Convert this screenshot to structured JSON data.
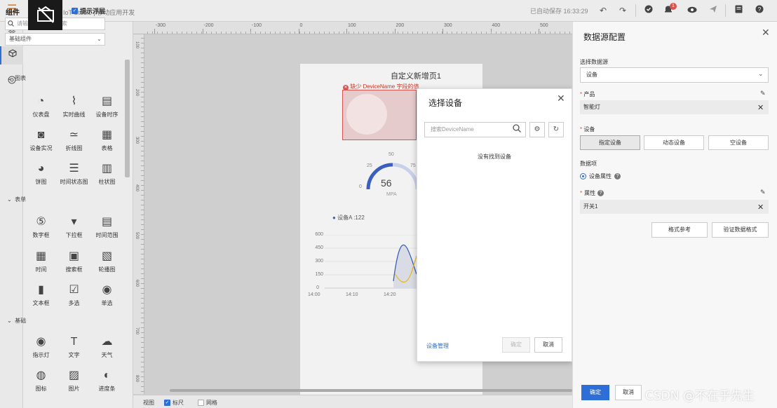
{
  "topbar": {
    "app_title": "IoT Studio | 移动应用开发",
    "autosave": "已自动保存 16:33:29",
    "notification_count": "1"
  },
  "panel": {
    "title": "组件",
    "show_float": "提示浮层",
    "search_placeholder": "请输入组件名称搜索",
    "basic_select": "基础组件",
    "sections": [
      "图表",
      "表单",
      "基础"
    ],
    "charts": [
      "仪表盘",
      "实时曲线",
      "设备时序",
      "设备实况",
      "折线图",
      "表格",
      "饼图",
      "时间状态图",
      "柱状图"
    ],
    "forms": [
      "数字框",
      "下拉框",
      "时间范围",
      "时间",
      "搜索框",
      "轮播图",
      "文本框",
      "多选",
      "单选"
    ],
    "basics": [
      "指示灯",
      "文字",
      "天气",
      "图标",
      "图片",
      "进度条"
    ]
  },
  "ruler": {
    "top_labels": [
      "-300",
      "-200",
      "-100",
      "0",
      "100",
      "200",
      "300",
      "400",
      "500"
    ],
    "left_labels": [
      "100",
      "200",
      "300",
      "400",
      "500",
      "600",
      "700",
      "800"
    ]
  },
  "canvas": {
    "page_title": "自定义新增页1",
    "warning": "缺少 DeviceName 字段的值",
    "gauge_value": "56",
    "gauge_unit": "MPA",
    "gauge_ticks": [
      "0",
      "25",
      "50",
      "75"
    ],
    "legend": "设备A :122",
    "y_labels": [
      "600",
      "450",
      "300",
      "150",
      "0"
    ],
    "x_labels": [
      "14:00",
      "14:10",
      "14:20"
    ],
    "footer_view": "视图",
    "footer_ruler": "标尺",
    "footer_grid": "网格"
  },
  "dialog": {
    "title": "选择设备",
    "search_placeholder": "搜索DeviceName",
    "empty_text": "没有找到设备",
    "device_mgmt": "设备管理",
    "ok": "确定",
    "cancel": "取消"
  },
  "rpanel": {
    "title": "数据源配置",
    "select_source_label": "选择数据源",
    "source_value": "设备",
    "product_label": "产品",
    "product_value": "智能灯",
    "device_label": "设备",
    "device_options": [
      "指定设备",
      "动态设备",
      "空设备"
    ],
    "data_item_label": "数据项",
    "radio_label": "设备属性",
    "attr_label": "属性",
    "attr_value": "开关1",
    "format_ref": "格式参考",
    "verify_format": "验证数据格式",
    "ok": "确定",
    "cancel": "取消"
  },
  "watermark": "CSDN @不在乎先生",
  "colors": {
    "accent": "#2d6fd6",
    "error": "#d9534f",
    "gauge": "#3b5fc0",
    "line_yellow": "#e8b928"
  }
}
